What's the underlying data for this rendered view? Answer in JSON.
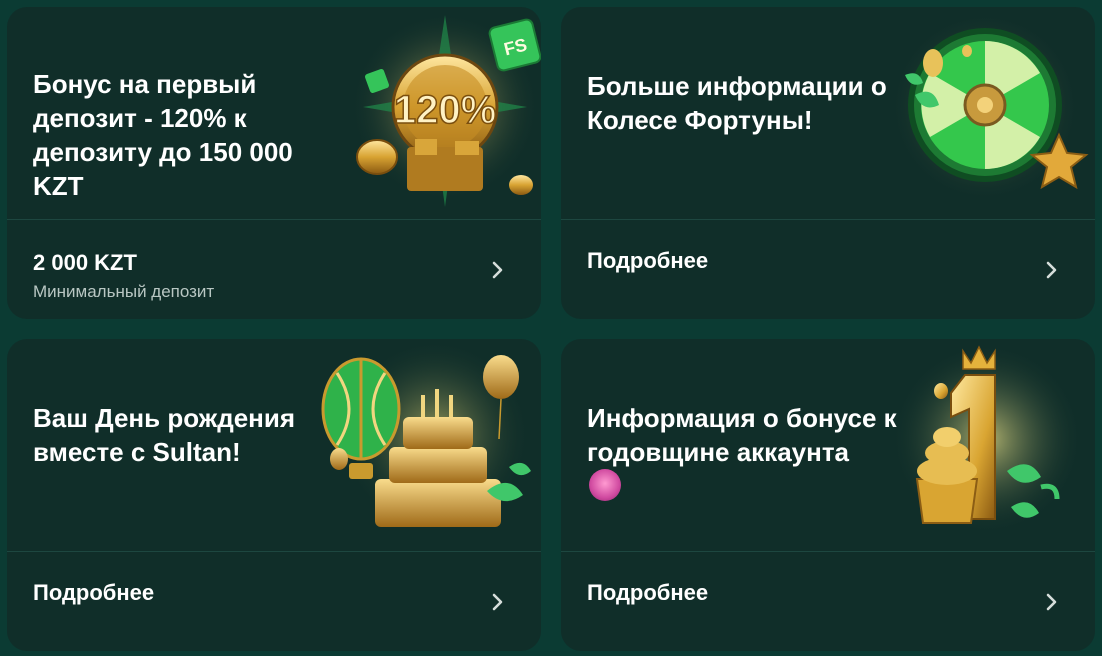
{
  "cards": [
    {
      "title": "Бонус на первый депозит - 120% к депозиту до 150 000 KZT",
      "footer_value": "2 000 KZT",
      "footer_sub": "Минимальный депозит",
      "art_text": "120%",
      "badge_text": "FS",
      "icon": "chevron-right-icon"
    },
    {
      "title": "Больше информации о Колесе Фортуны!",
      "footer_label": "Подробнее",
      "icon": "chevron-right-icon"
    },
    {
      "title": "Ваш День рождения вместе с Sultan!",
      "footer_label": "Подробнее",
      "icon": "chevron-right-icon"
    },
    {
      "title": "Информация о бонусе к годовщине аккаунта",
      "footer_label": "Подробнее",
      "icon": "chevron-right-icon"
    }
  ],
  "colors": {
    "background": "#0b3b33",
    "card": "#102e29",
    "accent_gold": "#e6b640",
    "accent_green": "#2fbf4a"
  }
}
